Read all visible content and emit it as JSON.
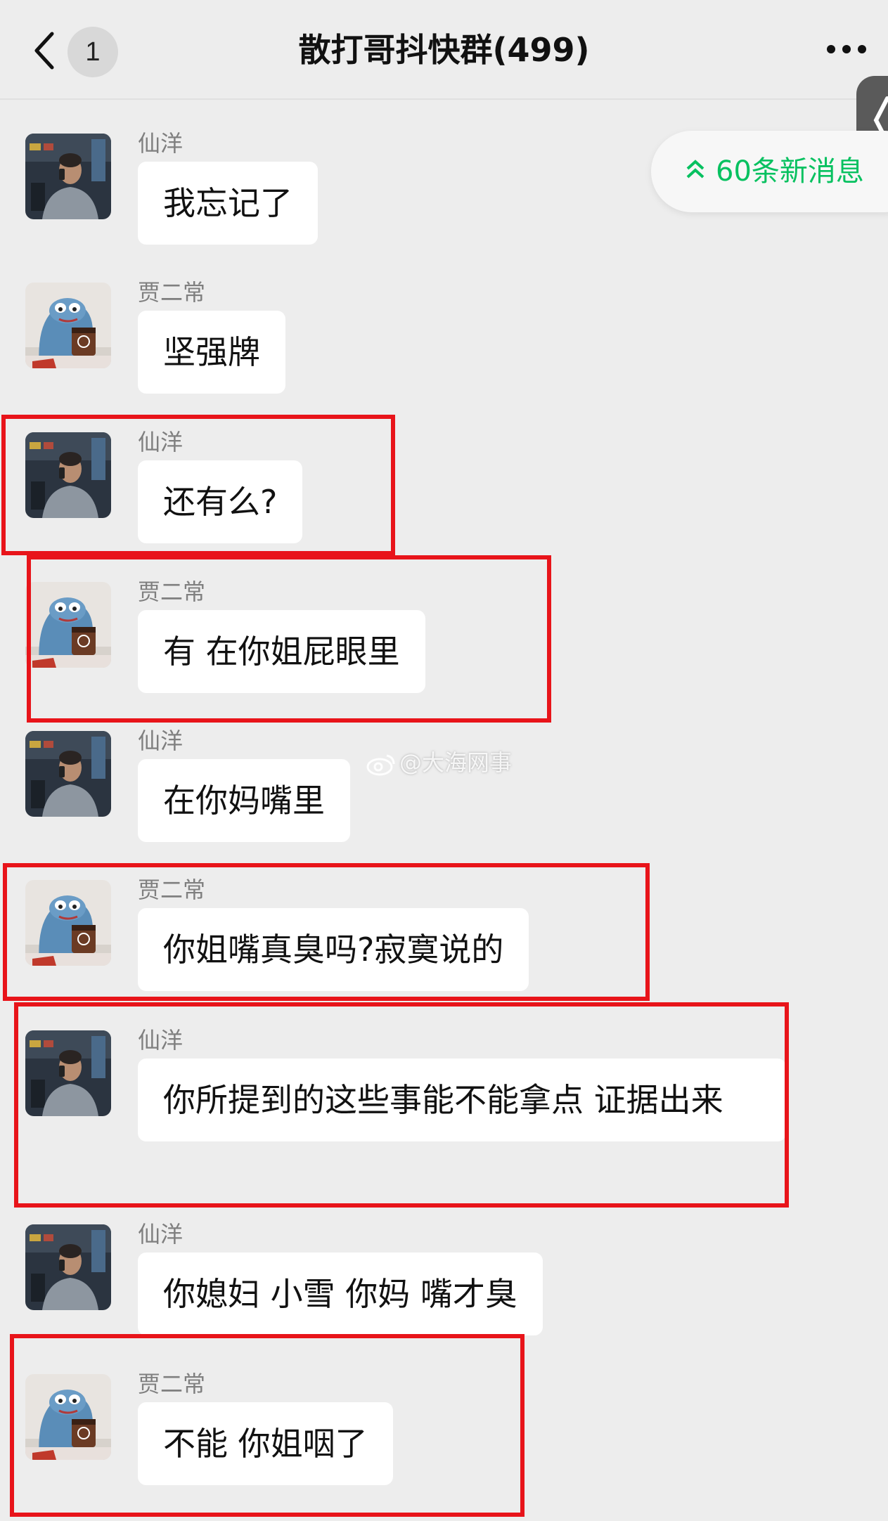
{
  "header": {
    "unread_count": "1",
    "title": "散打哥抖快群(499)"
  },
  "new_messages": {
    "label": "60条新消息"
  },
  "watermark": "@大海网事",
  "messages": [
    {
      "sender": "仙洋",
      "text": "我忘记了",
      "avatar": "man-phone-avatar"
    },
    {
      "sender": "贾二常",
      "text": "坚强牌",
      "avatar": "blue-plush-avatar"
    },
    {
      "sender": "仙洋",
      "text": "还有么?",
      "avatar": "man-phone-avatar"
    },
    {
      "sender": "贾二常",
      "text": "有 在你姐屁眼里",
      "avatar": "blue-plush-avatar"
    },
    {
      "sender": "仙洋",
      "text": "在你妈嘴里",
      "avatar": "man-phone-avatar"
    },
    {
      "sender": "贾二常",
      "text": "你姐嘴真臭吗?寂寞说的",
      "avatar": "blue-plush-avatar"
    },
    {
      "sender": "仙洋",
      "text": "你所提到的这些事能不能拿点 证据出来",
      "avatar": "man-phone-avatar"
    },
    {
      "sender": "仙洋",
      "text": "你媳妇 小雪 你妈 嘴才臭",
      "avatar": "man-phone-avatar"
    },
    {
      "sender": "贾二常",
      "text": "不能 你姐咽了",
      "avatar": "blue-plush-avatar"
    }
  ],
  "colors": {
    "background": "#ededed",
    "bubble": "#ffffff",
    "accent_green": "#07c160",
    "highlight_red": "#e8141a"
  }
}
